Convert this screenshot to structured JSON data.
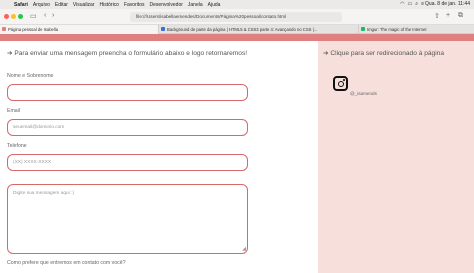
{
  "menubar": {
    "items": [
      "Safari",
      "Arquivo",
      "Editar",
      "Visualizar",
      "Histórico",
      "Favoritos",
      "Desenvolvedor",
      "Janela",
      "Ajuda"
    ],
    "clock": "Qua. 8 de jan.  11:44"
  },
  "browser": {
    "url": "file:///Users/isabellaemendes/Documents/Página%20pessoal/contato.html",
    "tabs": [
      {
        "label": "Página pessoal de Isabella",
        "favicon_color": "#e07f80"
      },
      {
        "label": "Background de parte da página | HTML5 & CSS3 parte 4: Avançando no CSS |...",
        "favicon_color": "#3b6fd8"
      },
      {
        "label": "Imgur: The magic of the Internet",
        "favicon_color": "#1bb76e"
      }
    ]
  },
  "page": {
    "form_title": "➔ Para enviar uma mensagem preencha o formulário abaixo e logo retornaremos!",
    "side_title": "➔ Clique para ser redirecionado à página",
    "fields": {
      "name_label": "Nome e Sobrenome",
      "email_label": "Email",
      "email_placeholder": "seuemail@dominio.com",
      "phone_label": "Telefone",
      "phone_placeholder": "(XX) XXXX-XXXX",
      "message_placeholder": "Digite sua mensagem aqui :)"
    },
    "contact_question": "Como prefere que entremos em contato com você?",
    "instagram_handle": "@_isamends"
  },
  "colors": {
    "accent": "#e07f80",
    "input_border": "#d7696a",
    "side_background": "#f7dfdc"
  }
}
